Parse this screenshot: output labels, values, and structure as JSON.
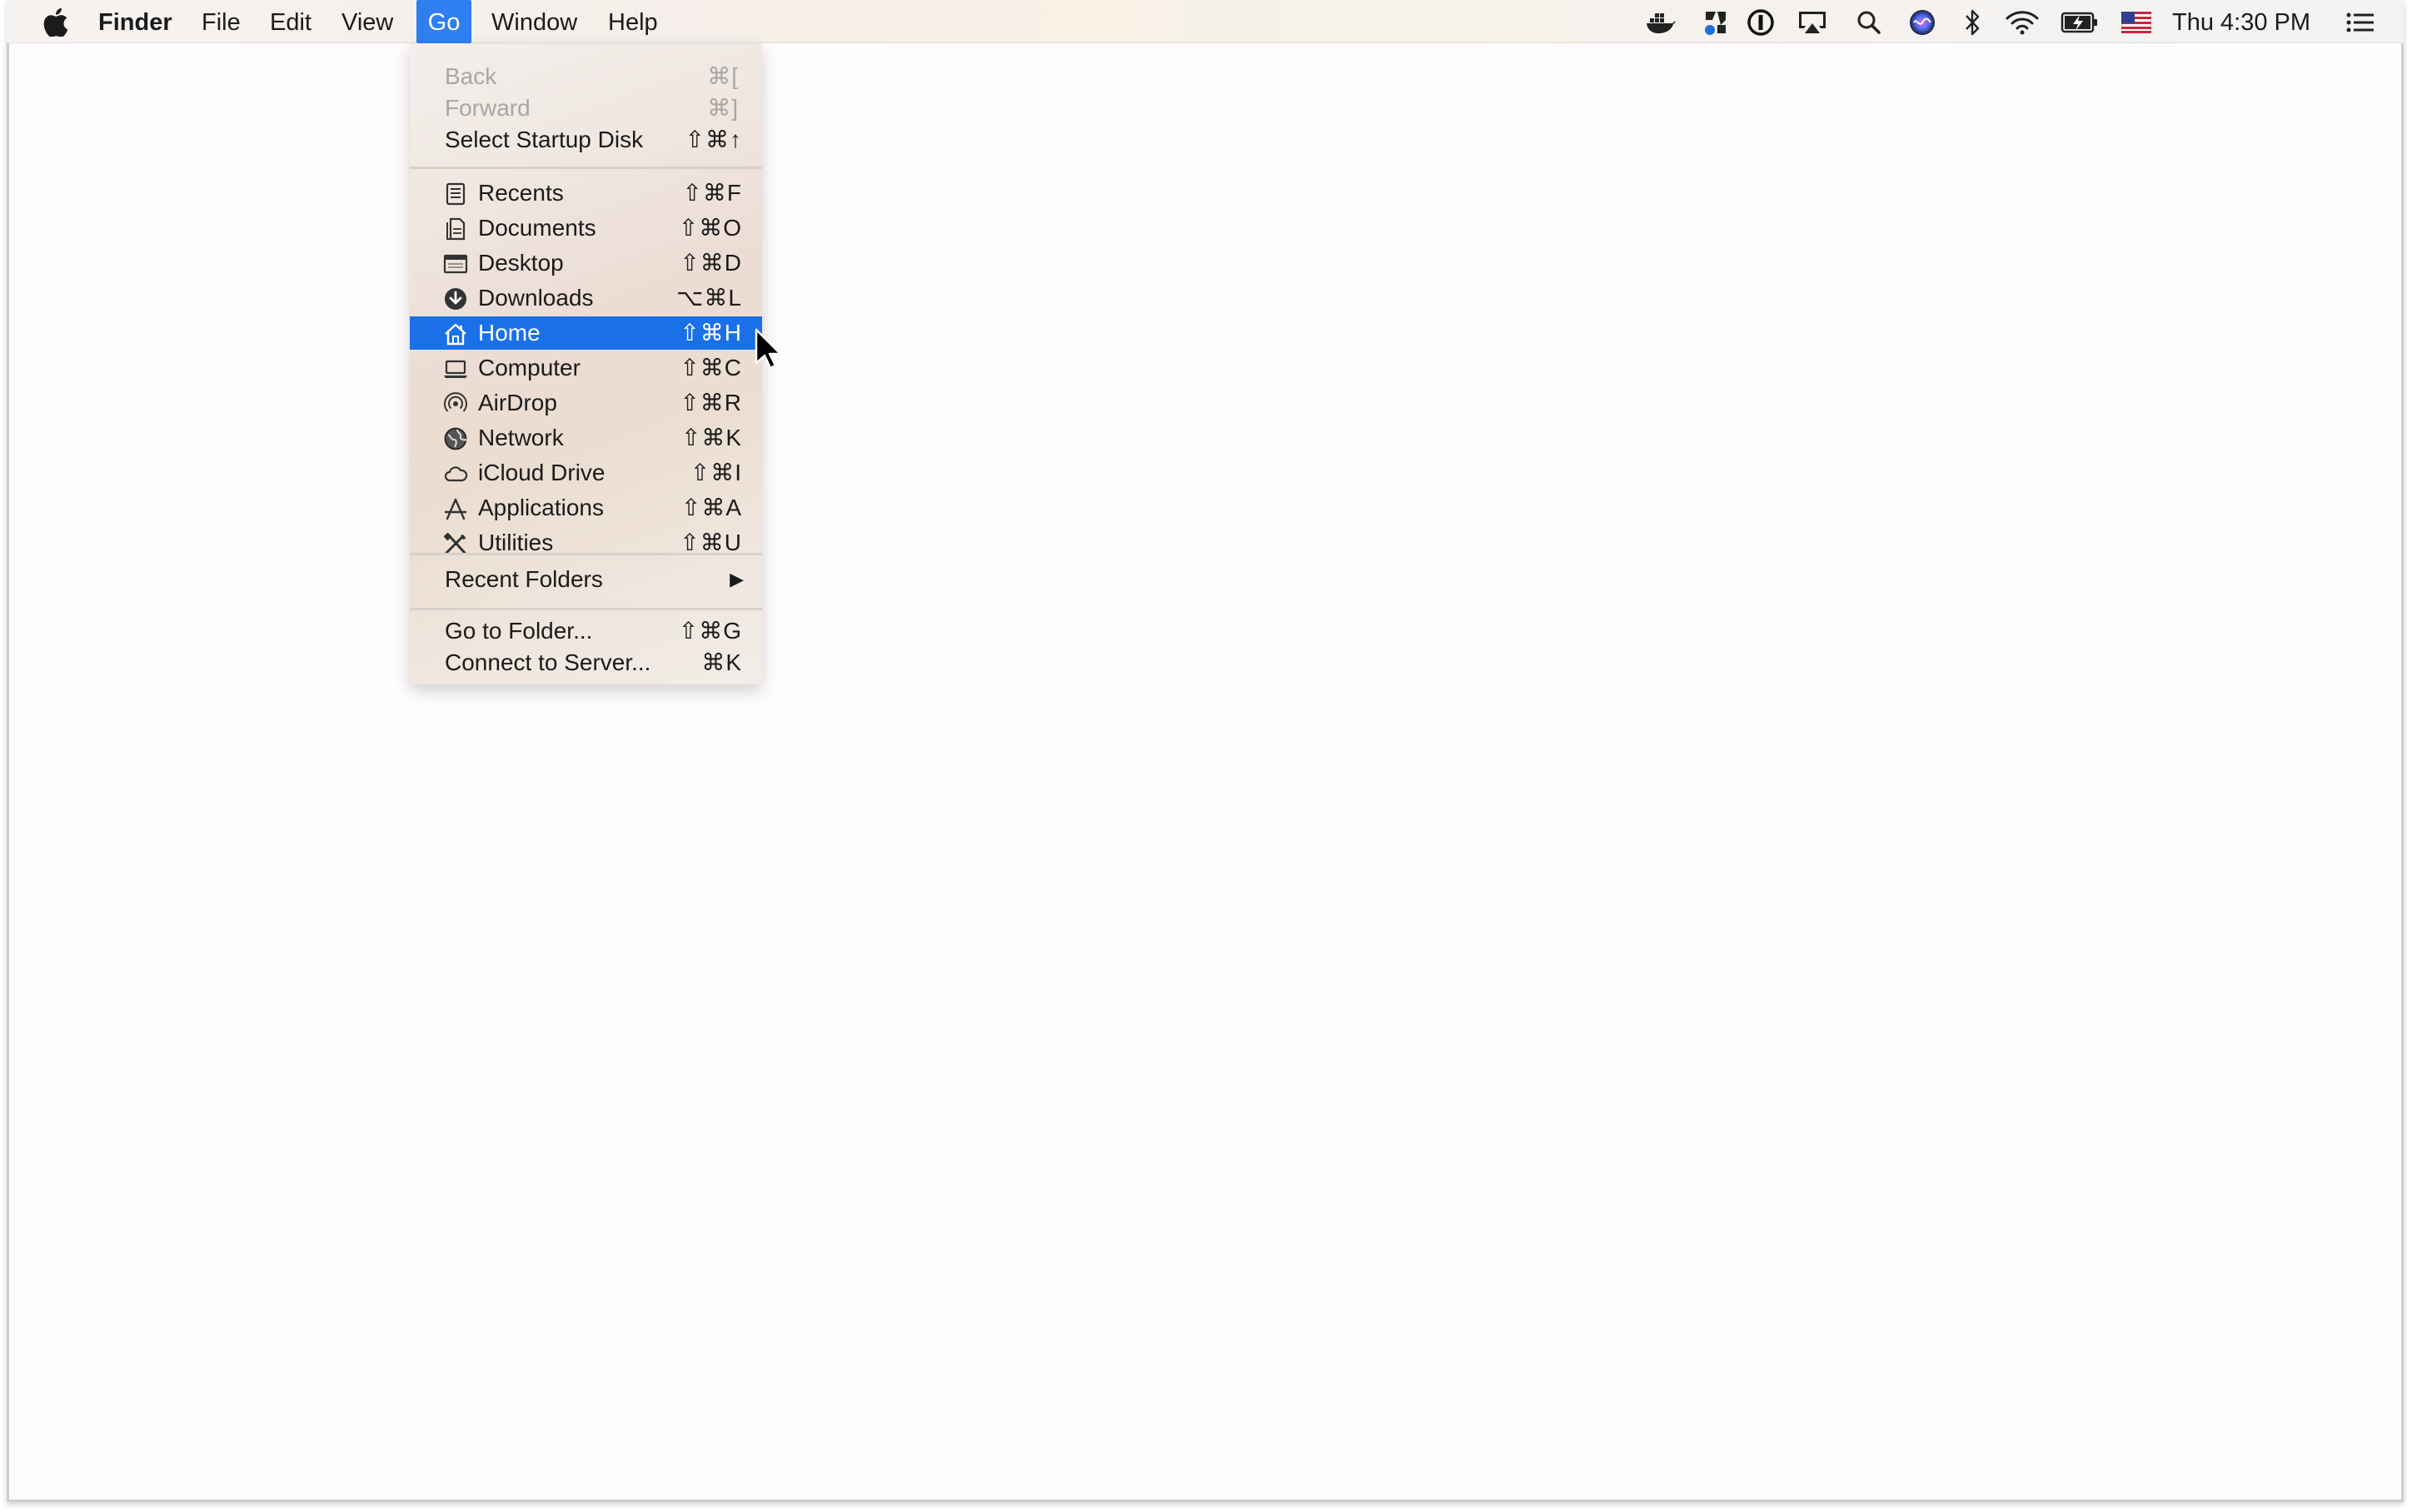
{
  "menubar": {
    "apple_icon": "apple-logo-icon",
    "app_name": "Finder",
    "menus": [
      "File",
      "Edit",
      "View",
      "Go",
      "Window",
      "Help"
    ],
    "active_menu": "Go",
    "clock": "Thu 4:30 PM",
    "status_icons": [
      "docker-icon",
      "team-icon",
      "1password-icon",
      "airplay-icon",
      "spotlight-search-icon",
      "siri-icon",
      "bluetooth-icon",
      "wifi-icon",
      "battery-icon",
      "us-flag-input-icon",
      "notification-center-icon"
    ]
  },
  "go_menu": {
    "nav": [
      {
        "label": "Back",
        "shortcut": "⌘[",
        "enabled": false
      },
      {
        "label": "Forward",
        "shortcut": "⌘]",
        "enabled": false
      },
      {
        "label": "Select Startup Disk",
        "shortcut": "⇧⌘↑",
        "enabled": true
      }
    ],
    "places": [
      {
        "label": "Recents",
        "shortcut": "⇧⌘F",
        "icon": "recents-icon"
      },
      {
        "label": "Documents",
        "shortcut": "⇧⌘O",
        "icon": "documents-icon"
      },
      {
        "label": "Desktop",
        "shortcut": "⇧⌘D",
        "icon": "desktop-icon"
      },
      {
        "label": "Downloads",
        "shortcut": "⌥⌘L",
        "icon": "downloads-icon"
      },
      {
        "label": "Home",
        "shortcut": "⇧⌘H",
        "icon": "home-icon",
        "selected": true
      },
      {
        "label": "Computer",
        "shortcut": "⇧⌘C",
        "icon": "computer-icon"
      },
      {
        "label": "AirDrop",
        "shortcut": "⇧⌘R",
        "icon": "airdrop-icon"
      },
      {
        "label": "Network",
        "shortcut": "⇧⌘K",
        "icon": "network-icon"
      },
      {
        "label": "iCloud Drive",
        "shortcut": "⇧⌘I",
        "icon": "icloud-icon"
      },
      {
        "label": "Applications",
        "shortcut": "⇧⌘A",
        "icon": "applications-icon"
      },
      {
        "label": "Utilities",
        "shortcut": "⇧⌘U",
        "icon": "utilities-icon"
      }
    ],
    "recent_folders": {
      "label": "Recent Folders",
      "submenu_arrow": "▶"
    },
    "actions": [
      {
        "label": "Go to Folder...",
        "shortcut": "⇧⌘G"
      },
      {
        "label": "Connect to Server...",
        "shortcut": "⌘K"
      }
    ]
  },
  "colors": {
    "menu_highlight": "#1a71e7",
    "menubar_active": "#2f7ff0"
  }
}
